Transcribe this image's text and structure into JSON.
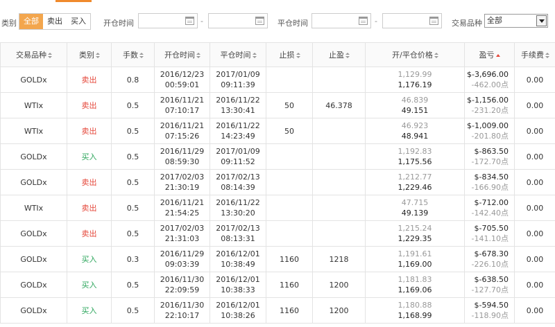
{
  "filters": {
    "type_label": "类别",
    "type_options": [
      "全部",
      "卖出",
      "买入"
    ],
    "type_active": 0,
    "open_time_label": "开仓时间",
    "close_time_label": "平仓时间",
    "dash": "-",
    "product_label": "交易品种",
    "product_value": "全部"
  },
  "table": {
    "columns": [
      "交易品种",
      "类别",
      "手数",
      "开仓时间",
      "平仓时间",
      "止损",
      "止盈",
      "开/平仓价格",
      "盈亏",
      "手续费"
    ],
    "rows": [
      {
        "product": "GOLDx",
        "side": "卖出",
        "side_type": "sell",
        "lots": "0.8",
        "open_date": "2016/12/23",
        "open_time": "00:59:01",
        "close_date": "2017/01/09",
        "close_time": "09:11:39",
        "sl": "",
        "tp": "",
        "open_price": "1,129.99",
        "close_price": "1,176.19",
        "pnl": "$-3,696.00",
        "points": "-462.00点",
        "fee": "0.00"
      },
      {
        "product": "WTIx",
        "side": "卖出",
        "side_type": "sell",
        "lots": "0.5",
        "open_date": "2016/11/21",
        "open_time": "07:10:17",
        "close_date": "2016/11/22",
        "close_time": "13:30:41",
        "sl": "50",
        "tp": "46.378",
        "open_price": "46.839",
        "close_price": "49.151",
        "pnl": "$-1,156.00",
        "points": "-231.20点",
        "fee": "0.00"
      },
      {
        "product": "WTIx",
        "side": "卖出",
        "side_type": "sell",
        "lots": "0.5",
        "open_date": "2016/11/21",
        "open_time": "07:15:26",
        "close_date": "2016/11/22",
        "close_time": "14:23:49",
        "sl": "50",
        "tp": "",
        "open_price": "46.923",
        "close_price": "48.941",
        "pnl": "$-1,009.00",
        "points": "-201.80点",
        "fee": "0.00"
      },
      {
        "product": "GOLDx",
        "side": "买入",
        "side_type": "buy",
        "lots": "0.5",
        "open_date": "2016/11/29",
        "open_time": "08:59:30",
        "close_date": "2017/01/09",
        "close_time": "09:11:52",
        "sl": "",
        "tp": "",
        "open_price": "1,192.83",
        "close_price": "1,175.56",
        "pnl": "$-863.50",
        "points": "-172.70点",
        "fee": "0.00"
      },
      {
        "product": "GOLDx",
        "side": "卖出",
        "side_type": "sell",
        "lots": "0.5",
        "open_date": "2017/02/03",
        "open_time": "21:30:19",
        "close_date": "2017/02/13",
        "close_time": "08:14:39",
        "sl": "",
        "tp": "",
        "open_price": "1,212.77",
        "close_price": "1,229.46",
        "pnl": "$-834.50",
        "points": "-166.90点",
        "fee": "0.00"
      },
      {
        "product": "WTIx",
        "side": "卖出",
        "side_type": "sell",
        "lots": "0.5",
        "open_date": "2016/11/21",
        "open_time": "21:54:25",
        "close_date": "2016/11/22",
        "close_time": "13:30:20",
        "sl": "",
        "tp": "",
        "open_price": "47.715",
        "close_price": "49.139",
        "pnl": "$-712.00",
        "points": "-142.40点",
        "fee": "0.00"
      },
      {
        "product": "GOLDx",
        "side": "卖出",
        "side_type": "sell",
        "lots": "0.5",
        "open_date": "2017/02/03",
        "open_time": "21:31:03",
        "close_date": "2017/02/13",
        "close_time": "08:13:31",
        "sl": "",
        "tp": "",
        "open_price": "1,215.24",
        "close_price": "1,229.35",
        "pnl": "$-705.50",
        "points": "-141.10点",
        "fee": "0.00"
      },
      {
        "product": "GOLDx",
        "side": "买入",
        "side_type": "buy",
        "lots": "0.3",
        "open_date": "2016/11/29",
        "open_time": "09:03:39",
        "close_date": "2016/12/01",
        "close_time": "10:38:49",
        "sl": "1160",
        "tp": "1218",
        "open_price": "1,191.61",
        "close_price": "1,169.00",
        "pnl": "$-678.30",
        "points": "-226.10点",
        "fee": "0.00"
      },
      {
        "product": "GOLDx",
        "side": "买入",
        "side_type": "buy",
        "lots": "0.5",
        "open_date": "2016/11/30",
        "open_time": "22:09:59",
        "close_date": "2016/12/01",
        "close_time": "10:38:33",
        "sl": "1160",
        "tp": "1200",
        "open_price": "1,181.83",
        "close_price": "1,169.06",
        "pnl": "$-638.50",
        "points": "-127.70点",
        "fee": "0.00"
      },
      {
        "product": "GOLDx",
        "side": "买入",
        "side_type": "buy",
        "lots": "0.5",
        "open_date": "2016/11/30",
        "open_time": "22:10:17",
        "close_date": "2016/12/01",
        "close_time": "10:38:26",
        "sl": "1160",
        "tp": "1200",
        "open_price": "1,180.88",
        "close_price": "1,168.99",
        "pnl": "$-594.50",
        "points": "-118.90点",
        "fee": "0.00"
      }
    ]
  },
  "colors": {
    "accent": "#f3a64d",
    "sell": "#e5473a",
    "buy": "#2aa55a"
  }
}
